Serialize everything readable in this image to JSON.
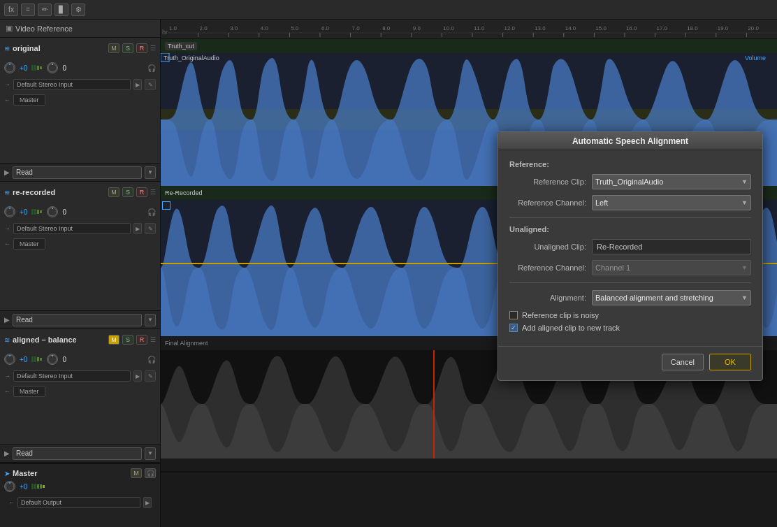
{
  "toolbar": {
    "buttons": [
      "fx",
      "=",
      "pencil",
      "volume",
      "gear"
    ]
  },
  "video_ref": {
    "label": "Video Reference"
  },
  "tracks": [
    {
      "id": "original",
      "name": "original",
      "icon": "≋",
      "m": "M",
      "s": "S",
      "r": "R",
      "vol": "+0",
      "db": "0",
      "input": "Default Stereo Input",
      "master": "Master",
      "read_label": "Read"
    },
    {
      "id": "re-recorded",
      "name": "re-recorded",
      "icon": "≋",
      "m": "M",
      "s": "S",
      "r": "R",
      "vol": "+0",
      "db": "0",
      "input": "Default Stereo Input",
      "master": "Master",
      "read_label": "Read"
    },
    {
      "id": "aligned-balance",
      "name": "aligned – balance",
      "icon": "≋",
      "m": "M",
      "m_active": true,
      "s": "S",
      "r": "R",
      "vol": "+0",
      "db": "0",
      "input": "Default Stereo Input",
      "master": "Master",
      "read_label": "Read"
    }
  ],
  "master": {
    "label": "Master",
    "icon": "➤",
    "m": "M",
    "output": "Default Output"
  },
  "timeline": {
    "format": "hms",
    "marks": [
      "1.0",
      "2.0",
      "3.0",
      "4.0",
      "5.0",
      "6.0",
      "7.0",
      "8.0",
      "9.0",
      "10.0",
      "11.0",
      "12.0",
      "13.0",
      "14.0",
      "15.0",
      "16.0",
      "17.0",
      "18.0",
      "19.0",
      "20.0"
    ]
  },
  "clips": {
    "truth_cut": "Truth_cut",
    "original_audio": "Truth_OriginalAudio",
    "volume_label": "Volume",
    "re_recorded": "Re-Recorded",
    "final_alignment": "Final Alignment"
  },
  "dialog": {
    "title": "Automatic Speech Alignment",
    "reference_section": "Reference:",
    "reference_clip_label": "Reference Clip:",
    "reference_clip_value": "Truth_OriginalAudio",
    "reference_channel_label": "Reference Channel:",
    "reference_channel_value": "Left",
    "unaligned_section": "Unaligned:",
    "unaligned_clip_label": "Unaligned Clip:",
    "unaligned_clip_value": "Re-Recorded",
    "unaligned_channel_label": "Reference Channel:",
    "unaligned_channel_value": "Channel 1",
    "alignment_label": "Alignment:",
    "alignment_value": "Balanced alignment and stretching",
    "checkbox_noisy_label": "Reference clip is noisy",
    "checkbox_noisy_checked": false,
    "checkbox_add_label": "Add aligned clip to new track",
    "checkbox_add_checked": true,
    "cancel_btn": "Cancel",
    "ok_btn": "OK"
  }
}
